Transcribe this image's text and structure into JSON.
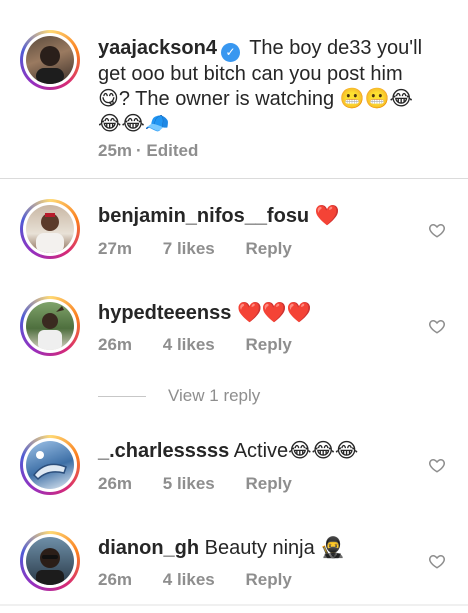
{
  "caption": {
    "username": "yaajackson4",
    "verified_badge": "✓",
    "text": "The boy de33 you'll get ooo but bitch can you post him 😋? The owner is watching 😬😬😂😂😂🧢",
    "time": "25m",
    "edited": "· Edited"
  },
  "comments": [
    {
      "username": "benjamin_nifos__fosu",
      "text": "❤️",
      "time": "27m",
      "likes": "7 likes",
      "reply": "Reply"
    },
    {
      "username": "hypedteeenss",
      "text": "❤️❤️❤️",
      "time": "26m",
      "likes": "4 likes",
      "reply": "Reply"
    },
    {
      "username": "_.charlesssss",
      "text": "Active😂😂😂",
      "time": "26m",
      "likes": "5 likes",
      "reply": "Reply"
    },
    {
      "username": "dianon_gh",
      "text": "Beauty ninja 🥷",
      "time": "26m",
      "likes": "4 likes",
      "reply": "Reply"
    }
  ],
  "view_replies": "View 1 reply",
  "colors": {
    "link_blue": "#3897f0",
    "muted": "#8e8e8e",
    "text": "#262626",
    "heart_red": "#e0245e"
  },
  "icons": {
    "like": "heart-outline-icon",
    "verified": "verified-badge-icon"
  }
}
